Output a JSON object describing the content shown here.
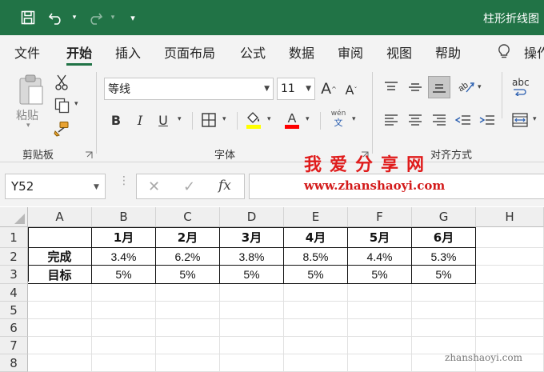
{
  "titlebar": {
    "title": "柱形折线图",
    "bg_color": "#217346"
  },
  "menu": [
    {
      "label": "文件"
    },
    {
      "label": "开始",
      "active": true
    },
    {
      "label": "插入"
    },
    {
      "label": "页面布局"
    },
    {
      "label": "公式"
    },
    {
      "label": "数据"
    },
    {
      "label": "审阅"
    },
    {
      "label": "视图"
    },
    {
      "label": "帮助"
    },
    {
      "label": "操作"
    }
  ],
  "ribbon": {
    "clipboard": {
      "paste_label": "粘贴",
      "group_label": "剪贴板"
    },
    "font": {
      "font_name": "等线",
      "font_size": "11",
      "group_label": "字体",
      "phonetic_top": "wén",
      "phonetic_bottom": "文",
      "bold": "B",
      "italic": "I",
      "underline": "U"
    },
    "alignment": {
      "group_label": "对齐方式",
      "wrap_text": "abc"
    }
  },
  "formula_bar": {
    "name_box": "Y52",
    "fx": "fx",
    "formula": ""
  },
  "sheet": {
    "columns": [
      "A",
      "B",
      "C",
      "D",
      "E",
      "F",
      "G",
      "H"
    ],
    "rows": [
      "1",
      "2",
      "3",
      "4",
      "5",
      "6",
      "7",
      "8"
    ],
    "headers": [
      "1月",
      "2月",
      "3月",
      "4月",
      "5月",
      "6月"
    ],
    "row_labels": [
      "完成",
      "目标"
    ],
    "completed": [
      "3.4%",
      "6.2%",
      "3.8%",
      "8.5%",
      "4.4%",
      "5.3%"
    ],
    "target": [
      "5%",
      "5%",
      "5%",
      "5%",
      "5%",
      "5%"
    ]
  },
  "watermark": {
    "text": "我爱分享网",
    "url": "www.zhanshaoyi.com",
    "corner": "zhanshaoyi.com"
  }
}
